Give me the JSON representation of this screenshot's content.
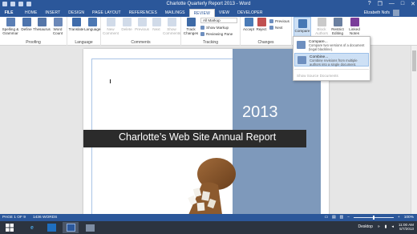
{
  "window": {
    "title": "Charlotte Quarterly Report 2013 - Word",
    "controls": [
      "?",
      "❐",
      "—",
      "□",
      "✕"
    ]
  },
  "tabs": {
    "file": "FILE",
    "items": [
      "HOME",
      "INSERT",
      "DESIGN",
      "PAGE LAYOUT",
      "REFERENCES",
      "MAILINGS",
      "REVIEW",
      "VIEW",
      "DEVELOPER"
    ],
    "active": "REVIEW",
    "user": "Elizabeth Nofs"
  },
  "ribbon": {
    "proofing": {
      "label": "Proofing",
      "spelling": "Spelling & Grammar",
      "define": "Define",
      "thesaurus": "Thesaurus",
      "word_count": "Word Count"
    },
    "language": {
      "label": "Language",
      "translate": "Translate",
      "language": "Language"
    },
    "comments": {
      "label": "Comments",
      "new": "New Comment",
      "delete": "Delete",
      "previous": "Previous",
      "next": "Next",
      "show": "Show Comments"
    },
    "tracking": {
      "label": "Tracking",
      "track_changes": "Track Changes",
      "markup_select": "All Markup",
      "show_markup": "Show Markup",
      "reviewing_pane": "Reviewing Pane"
    },
    "changes": {
      "label": "Changes",
      "accept": "Accept",
      "reject": "Reject",
      "previous": "Previous",
      "next": "Next"
    },
    "compare": {
      "compare": "Compare",
      "block_authors": "Block Authors",
      "restrict_editing": "Restrict Editing",
      "linked_notes": "Linked Notes"
    }
  },
  "compare_menu": {
    "items": [
      {
        "title": "Compare...",
        "desc": "Compare two versions of a document (legal blackline)."
      },
      {
        "title": "Combine...",
        "desc": "Combine revisions from multiple authors into a single document."
      }
    ],
    "show_source": "Show Source Documents"
  },
  "document": {
    "year": "2013",
    "banner_title": "Charlotte’s Web Site Annual Report"
  },
  "statusbar": {
    "page": "PAGE 1 OF 9",
    "words": "1436 WORDS",
    "zoom": "100%"
  },
  "taskbar": {
    "desktop": "Desktop",
    "time": "11:00 AM",
    "date": "5/7/2013"
  },
  "colors": {
    "word_blue": "#2b579a",
    "page_panel": "#7e99bb",
    "banner": "#2b2b2b",
    "highlight": "#cde0f5"
  }
}
